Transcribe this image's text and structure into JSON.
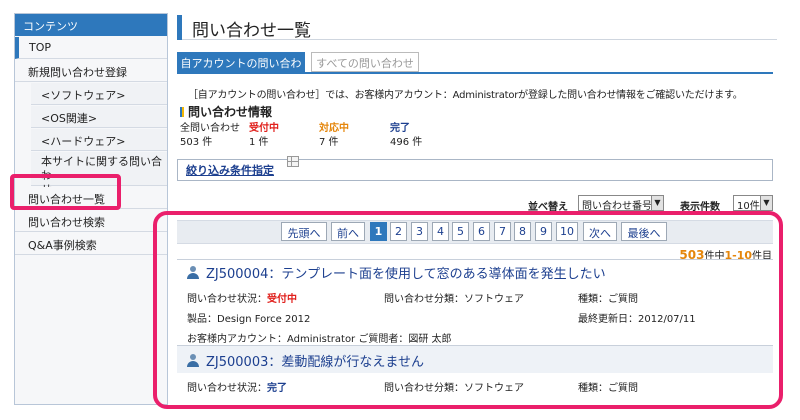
{
  "sidebar": {
    "header": "コンテンツ",
    "items": {
      "top": "TOP",
      "new": "新規問い合わせ登録",
      "software": "<ソフトウェア>",
      "os": "<OS関連>",
      "hardware": "<ハードウェア>",
      "about_line1": "本サイトに関する問い合わ",
      "about_line2": "せ",
      "list": "問い合わせ一覧",
      "search": "問い合わせ検索",
      "qa": "Q&A事例検索"
    }
  },
  "page_title": "問い合わせ一覧",
  "tabs": {
    "mine": "自アカウントの問い合わせ",
    "all": "すべての問い合わせ"
  },
  "description": "［自アカウントの問い合わせ］では、お客様内アカウント：Administratorが登録した問い合わせ情報をご確認いただけます。",
  "info": {
    "title": "問い合わせ情報",
    "stats": [
      {
        "label": "全問い合わせ",
        "value": "503 件"
      },
      {
        "label": "受付中",
        "value": "1 件"
      },
      {
        "label": "対応中",
        "value": "7 件"
      },
      {
        "label": "完了",
        "value": "496 件"
      }
    ]
  },
  "filter_label": "絞り込み条件指定",
  "sort": {
    "sort_label": "並べ替え",
    "sort_value": "問い合わせ番号",
    "count_label": "表示件数",
    "count_value": "10件"
  },
  "pagination": {
    "first": "先頭へ",
    "prev": "前へ",
    "pages": [
      "1",
      "2",
      "3",
      "4",
      "5",
      "6",
      "7",
      "8",
      "9",
      "10"
    ],
    "next": "次へ",
    "last": "最後へ"
  },
  "result_count": {
    "total": "503",
    "mid": "件中",
    "range": "1-10",
    "suffix": "件目"
  },
  "results": [
    {
      "id": "ZJ500004",
      "title": "：テンプレート面を使用して窓のある導体面を発生したい",
      "status_label": "問い合わせ状況：",
      "status": "受付中",
      "category": "問い合わせ分類：ソフトウェア",
      "type": "種類：ご質問",
      "product": "製品：Design Force 2012",
      "updated": "最終更新日：2012/07/11",
      "account": "お客様内アカウント：Administrator ご質問者：図研 太郎"
    },
    {
      "id": "ZJ500003",
      "title": "：差動配線が行なえません",
      "status_label": "問い合わせ状況：",
      "status": "完了",
      "category": "問い合わせ分類：ソフトウェア",
      "type": "種類：ご質問"
    }
  ],
  "colors": {
    "accent": "#2e78bc",
    "highlight": "#ea1f6b",
    "status_open": "#e0201c",
    "status_done": "#1c3f8f"
  }
}
